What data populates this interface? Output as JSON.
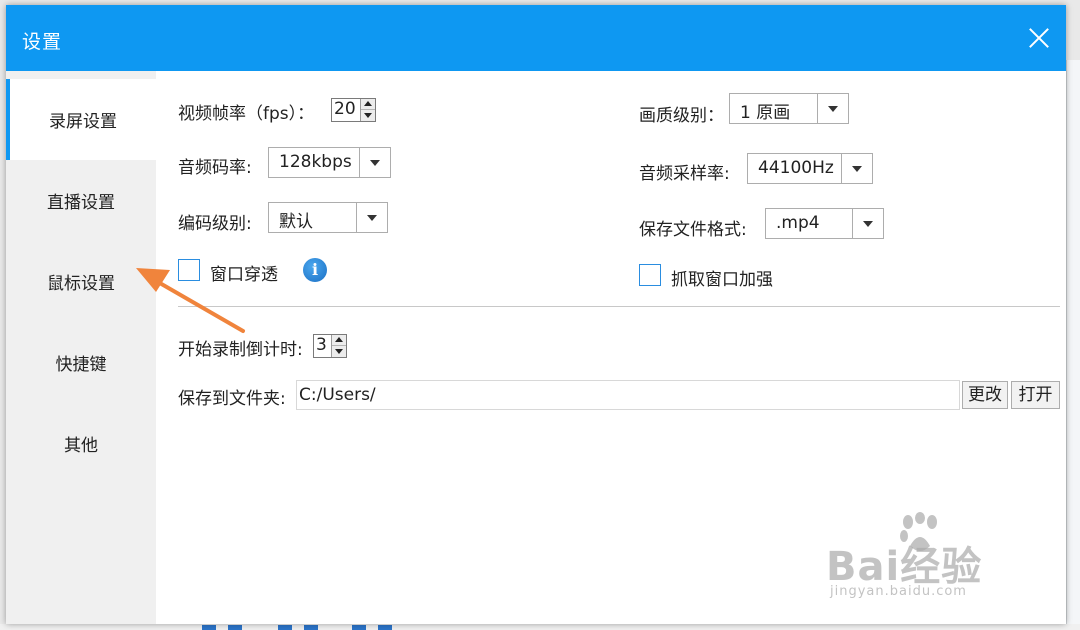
{
  "dialog": {
    "title": "设置"
  },
  "sidebar": {
    "items": [
      {
        "label": "录屏设置"
      },
      {
        "label": "直播设置"
      },
      {
        "label": "鼠标设置"
      },
      {
        "label": "快捷键"
      },
      {
        "label": "其他"
      }
    ],
    "active_index": 0
  },
  "settings": {
    "fps": {
      "label": "视频帧率（fps）：",
      "value": "20"
    },
    "quality": {
      "label": "画质级别：",
      "value": "1 原画"
    },
    "audio_bitrate": {
      "label": "音频码率:",
      "value": "128kbps"
    },
    "sample_rate": {
      "label": "音频采样率:",
      "value": "44100Hz"
    },
    "encode_level": {
      "label": "编码级别:",
      "value": "默认"
    },
    "save_format": {
      "label": "保存文件格式:",
      "value": ".mp4"
    },
    "window_penetrate": {
      "label": "窗口穿透",
      "checked": false
    },
    "capture_enhance": {
      "label": "抓取窗口加强",
      "checked": false
    },
    "countdown": {
      "label": "开始录制倒计时:",
      "value": "3"
    },
    "save_folder": {
      "label": "保存到文件夹:",
      "value": "C:/Users/"
    },
    "change_button": "更改",
    "open_button": "打开"
  },
  "watermark": {
    "brand": "Bai经验",
    "sub": "jingyan.baidu.com"
  },
  "colors": {
    "accent": "#0e98f2",
    "annotation_arrow": "#f0843c"
  }
}
